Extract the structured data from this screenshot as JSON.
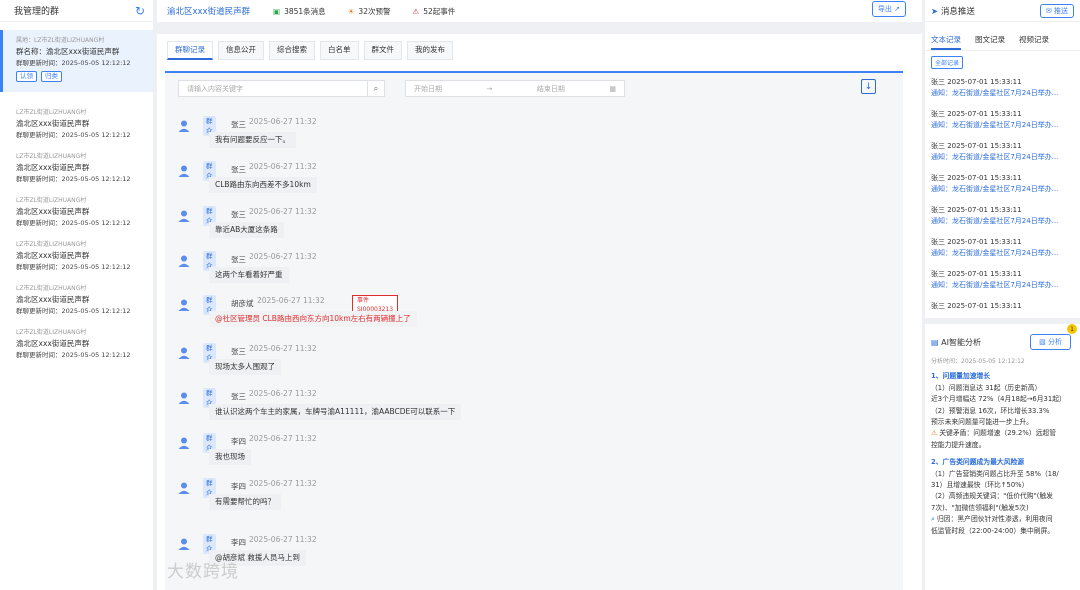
{
  "left": {
    "title": "我管理的群",
    "groups": [
      {
        "line1": "属地：LZ市ZL街道LIZHUANG村",
        "line2": "群名称：渝北区xxx街道民声群",
        "line3": "群聊更新时间：2025-05-05 12:12:12",
        "tags": [
          "认领",
          "归类"
        ]
      },
      {
        "line1": "LZ市ZL街道LIZHUANG村",
        "line2": "渝北区xxx街道民声群",
        "line3": "群聊更新时间：2025-05-05 12:12:12"
      },
      {
        "line1": "LZ市ZL街道LIZHUANG村",
        "line2": "渝北区xxx街道民声群",
        "line3": "群聊更新时间：2025-05-05 12:12:12"
      },
      {
        "line1": "LZ市ZL街道LIZHUANG村",
        "line2": "渝北区xxx街道民声群",
        "line3": "群聊更新时间：2025-05-05 12:12:12"
      },
      {
        "line1": "LZ市ZL街道LIZHUANG村",
        "line2": "渝北区xxx街道民声群",
        "line3": "群聊更新时间：2025-05-05 12:12:12"
      },
      {
        "line1": "LZ市ZL街道LIZHUANG村",
        "line2": "渝北区xxx街道民声群",
        "line3": "群聊更新时间：2025-05-05 12:12:12"
      },
      {
        "line1": "LZ市ZL街道LIZHUANG村",
        "line2": "渝北区xxx街道民声群",
        "line3": "群聊更新时间：2025-05-05 12:12:12"
      }
    ]
  },
  "header": {
    "group_title": "渝北区xxx街道民声群",
    "messages": "3851条消息",
    "warnings": "32次预警",
    "events": "52起事件",
    "export": "导出"
  },
  "tabs": [
    "群聊记录",
    "信息公开",
    "综合搜索",
    "白名单",
    "群文件",
    "我的发布"
  ],
  "search": {
    "placeholder": "请输入内容关键字",
    "start": "开始日期",
    "arrow": "→",
    "end": "结束日期"
  },
  "messages": [
    {
      "role": "群众",
      "name": "张三",
      "time": "2025-06-27 11:32",
      "text": "我有问题要反应一下。"
    },
    {
      "role": "群众",
      "name": "张三",
      "time": "2025-06-27 11:32",
      "text": "CLB路由东向西差不多10km"
    },
    {
      "role": "群众",
      "name": "张三",
      "time": "2025-06-27 11:32",
      "text": "靠近AB大厦这条路"
    },
    {
      "role": "群众",
      "name": "张三",
      "time": "2025-06-27 11:32",
      "text": "这两个车看着好严重"
    },
    {
      "role": "群众",
      "name": "胡彦斌",
      "time": "2025-06-27 11:32",
      "text": "@社区管理员 CLB路由西向东方向10km左右有两辆撞上了",
      "event": "事件 SJ00003213"
    },
    {
      "role": "群众",
      "name": "张三",
      "time": "2025-06-27 11:32",
      "text": "现场太多人围观了"
    },
    {
      "role": "群众",
      "name": "张三",
      "time": "2025-06-27 11:32",
      "text": "谁认识这两个车主的家属，车牌号渝A11111，渝AABCDE可以联系一下"
    },
    {
      "role": "群众",
      "name": "李四",
      "time": "2025-06-27 11:32",
      "text": "我也现场"
    },
    {
      "role": "群众",
      "name": "李四",
      "time": "2025-06-27 11:32",
      "text": "有需要帮忙的吗？"
    },
    {
      "role": "群众",
      "name": "李四",
      "time": "2025-06-27 11:32",
      "text": "@胡彦斌 救援人员马上到"
    }
  ],
  "watermark": "大数跨境",
  "right": {
    "title": "消息推送",
    "push": "推送",
    "tabs": [
      "文本记录",
      "图文记录",
      "视频记录"
    ],
    "all": "全部记录",
    "notifs": [
      {
        "who": "张三 2025-07-01 15:33:11",
        "text": "通知：龙石街道/金星社区7月24日举办..."
      },
      {
        "who": "张三 2025-07-01 15:33:11",
        "text": "通知：龙石街道/金星社区7月24日举办..."
      },
      {
        "who": "张三 2025-07-01 15:33:11",
        "text": "通知：龙石街道/金星社区7月24日举办..."
      },
      {
        "who": "张三 2025-07-01 15:33:11",
        "text": "通知：龙石街道/金星社区7月24日举办..."
      },
      {
        "who": "张三 2025-07-01 15:33:11",
        "text": "通知：龙石街道/金星社区7月24日举办..."
      },
      {
        "who": "张三 2025-07-01 15:33:11",
        "text": "通知：龙石街道/金星社区7月24日举办..."
      },
      {
        "who": "张三 2025-07-01 15:33:11",
        "text": "通知：龙石街道/金星社区7月24日举办..."
      },
      {
        "who": "张三 2025-07-01 15:33:11",
        "text": ""
      }
    ],
    "ai": {
      "title": "AI智能分析",
      "btn": "分析",
      "badge": "1",
      "time": "分析时间：2025-05-05 12:12:12",
      "h1": "1、问题量加速增长",
      "p1a": "（1）问题消息达 31起（历史新高）",
      "p1b": "近3个月增幅达 72%（4月18起→6月31起）",
      "p1c": "（2）预警消息 16次，环比增长33.3%",
      "p1d": "预示未来问题量可能进一步上升。",
      "p1e": "关键矛盾：问题增速（29.2%）远超管",
      "p1f": "控能力提升速度。",
      "h2": "2、广告类问题成为最大风险源",
      "p2a": "（1）广告营销类问题占比升至 58%（18/",
      "p2b": "31）且增速最快（环比↑50%）",
      "p2c": "（2）高频违规关键词：\"低价代购\"(触发",
      "p2d": "7次)、\"加微信领福利\"(触发5次)",
      "p2e": "归因：黑产团伙针对性渗透，利用夜间",
      "p2f": "低监管时段（22:00-24:00）集中刷屏。"
    }
  }
}
